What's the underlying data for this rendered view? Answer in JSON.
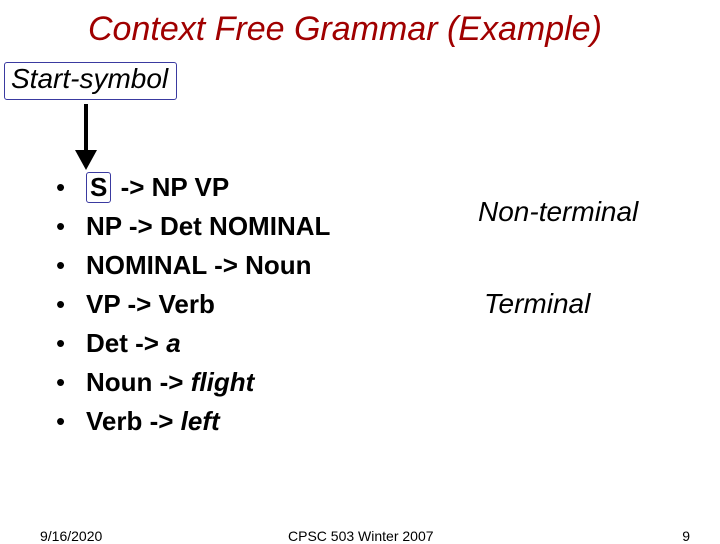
{
  "title": "Context Free Grammar (Example)",
  "start_label": "Start-symbol",
  "rules": {
    "r1_sym": "S",
    "r1_rest": " -> NP VP",
    "r2": "NP -> Det NOMINAL",
    "r3": "NOMINAL -> Noun",
    "r4": "VP -> Verb",
    "r5_lhs": "Det -> ",
    "r5_t": "a",
    "r6_lhs": "Noun -> ",
    "r6_t": "flight",
    "r7_lhs": "Verb -> ",
    "r7_t": "left"
  },
  "labels": {
    "nonterminal": "Non-terminal",
    "terminal": "Terminal"
  },
  "footer": {
    "date": "9/16/2020",
    "course": "CPSC 503 Winter 2007",
    "page": "9"
  },
  "bullet": "•"
}
